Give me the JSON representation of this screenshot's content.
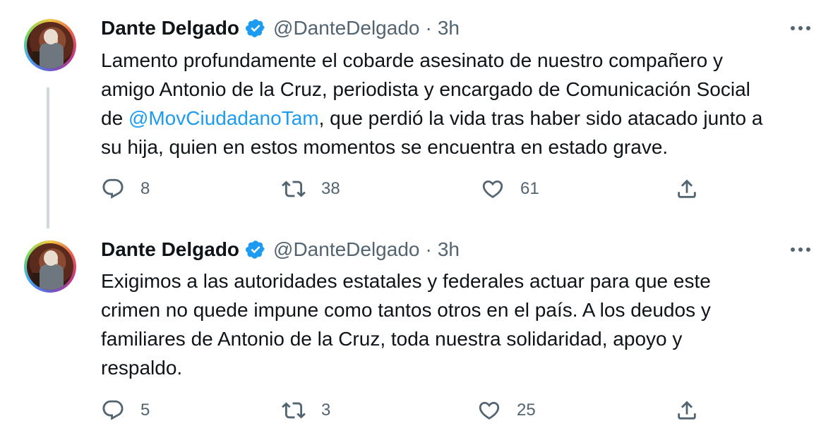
{
  "tweets": [
    {
      "name": "Dante Delgado",
      "handle": "@DanteDelgado",
      "separator": "·",
      "time": "3h",
      "lines": [
        {
          "before": "Lamento profundamente el cobarde asesinato de nuestro compañero y",
          "mention": "",
          "after": ""
        },
        {
          "before": "amigo Antonio de la Cruz, periodista y encargado de Comunicación Social",
          "mention": "",
          "after": ""
        },
        {
          "before": "de ",
          "mention": "@MovCiudadanoTam",
          "after": ", que perdió la vida tras haber sido atacado junto a"
        },
        {
          "before": "su hija, quien en estos momentos se encuentra en estado grave.",
          "mention": "",
          "after": ""
        }
      ],
      "replies": "8",
      "retweets": "38",
      "likes": "61"
    },
    {
      "name": "Dante Delgado",
      "handle": "@DanteDelgado",
      "separator": "·",
      "time": "3h",
      "lines": [
        {
          "before": "Exigimos a las autoridades estatales y federales actuar para que este",
          "mention": "",
          "after": ""
        },
        {
          "before": "crimen no quede impune como tantos otros en el país. A los deudos y",
          "mention": "",
          "after": ""
        },
        {
          "before": "familiares de Antonio de la Cruz, toda nuestra solidaridad, apoyo y",
          "mention": "",
          "after": ""
        },
        {
          "before": "respaldo.",
          "mention": "",
          "after": ""
        }
      ],
      "replies": "5",
      "retweets": "3",
      "likes": "25"
    }
  ],
  "icons": {
    "verified": "verified-badge-icon",
    "more": "more-options-icon",
    "reply": "reply-icon",
    "retweet": "retweet-icon",
    "like": "heart-icon",
    "share": "share-icon"
  },
  "colors": {
    "text": "#0f1419",
    "secondary": "#536471",
    "mention": "#1d9bf0",
    "verified": "#1d9bf0",
    "thread_line": "#cfd9de"
  }
}
